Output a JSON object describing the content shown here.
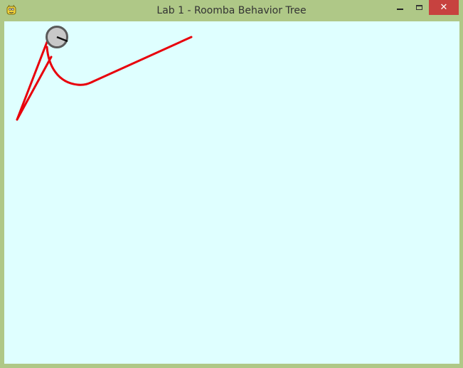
{
  "window": {
    "title": "Lab 1 - Roomba Behavior Tree",
    "controls": {
      "minimize_icon": "minimize-icon",
      "maximize_icon": "maximize-icon",
      "close_glyph": "✕"
    }
  },
  "colors": {
    "frame": "#afc887",
    "canvas_background": "#dfffff",
    "path": "#e8000b",
    "roomba_body": "#c8c8c8",
    "roomba_outline": "#5a5a5a",
    "close_button": "#c7423f"
  }
}
